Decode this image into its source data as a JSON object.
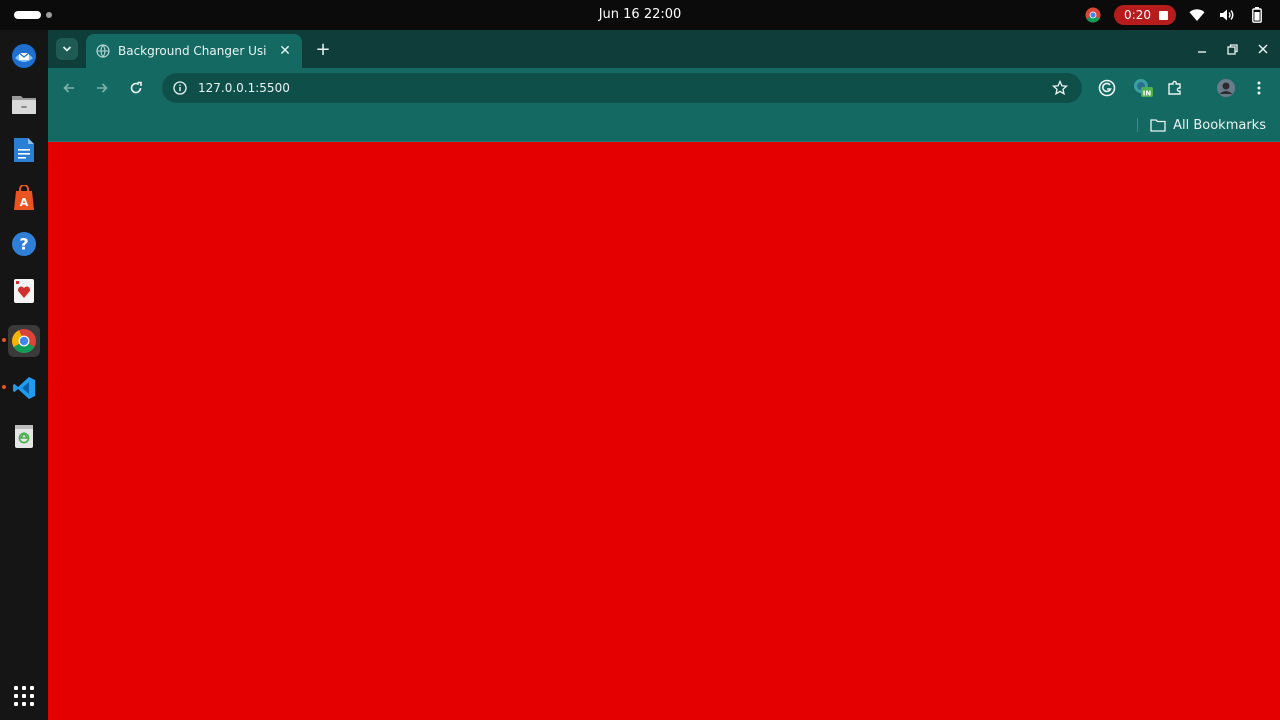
{
  "system": {
    "clock": "Jun 16  22:00",
    "recording_time": "0:20"
  },
  "dock": {
    "items": [
      {
        "name": "thunderbird-icon"
      },
      {
        "name": "files-icon"
      },
      {
        "name": "writer-icon"
      },
      {
        "name": "app-center-icon"
      },
      {
        "name": "help-icon"
      },
      {
        "name": "solitaire-icon"
      },
      {
        "name": "chrome-icon",
        "active": true
      },
      {
        "name": "vscode-icon"
      },
      {
        "name": "trash-icon"
      }
    ]
  },
  "browser": {
    "tab": {
      "title": "Background Changer Usi",
      "close_glyph": "✕"
    },
    "new_tab_glyph": "+",
    "address": {
      "url": "127.0.0.1:5500"
    },
    "bookmarks_bar": {
      "all_bookmarks_label": "All Bookmarks"
    },
    "page": {
      "background_color": "#e50000"
    }
  },
  "colors": {
    "browser_frame": "#156963",
    "tabstrip": "#0f3d3a",
    "recording": "#b71c1c"
  }
}
